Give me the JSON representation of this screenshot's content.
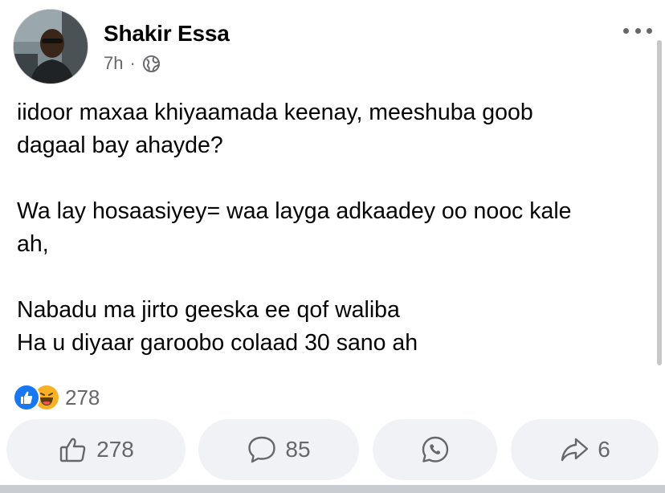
{
  "post": {
    "author": "Shakir Essa",
    "time": "7h",
    "separator": "·",
    "audience_icon": "globe-icon",
    "more_icon": "more-options-icon",
    "lines": [
      "iidoor maxaa khiyaamada keenay, meeshuba goob",
      "dagaal bay ahayde?",
      "",
      "Wa lay hosaasiyey= waa layga adkaadey oo nooc kale",
      "ah,",
      "",
      "Nabadu ma jirto geeska ee qof waliba",
      "Ha u diyaar garoobo colaad 30 sano ah"
    ]
  },
  "reactions": {
    "icons": [
      "like-icon",
      "haha-icon"
    ],
    "count": "278"
  },
  "actions": {
    "like": {
      "icon": "thumbs-up-icon",
      "count": "278"
    },
    "comment": {
      "icon": "comment-icon",
      "count": "85"
    },
    "whatsapp": {
      "icon": "whatsapp-icon"
    },
    "share": {
      "icon": "share-icon",
      "count": "6"
    }
  },
  "colors": {
    "text": "#050505",
    "secondary": "#65676b",
    "like_blue": "#1877f2",
    "haha_yellow": "#f7b125",
    "button_bg": "#f0f2f5"
  }
}
